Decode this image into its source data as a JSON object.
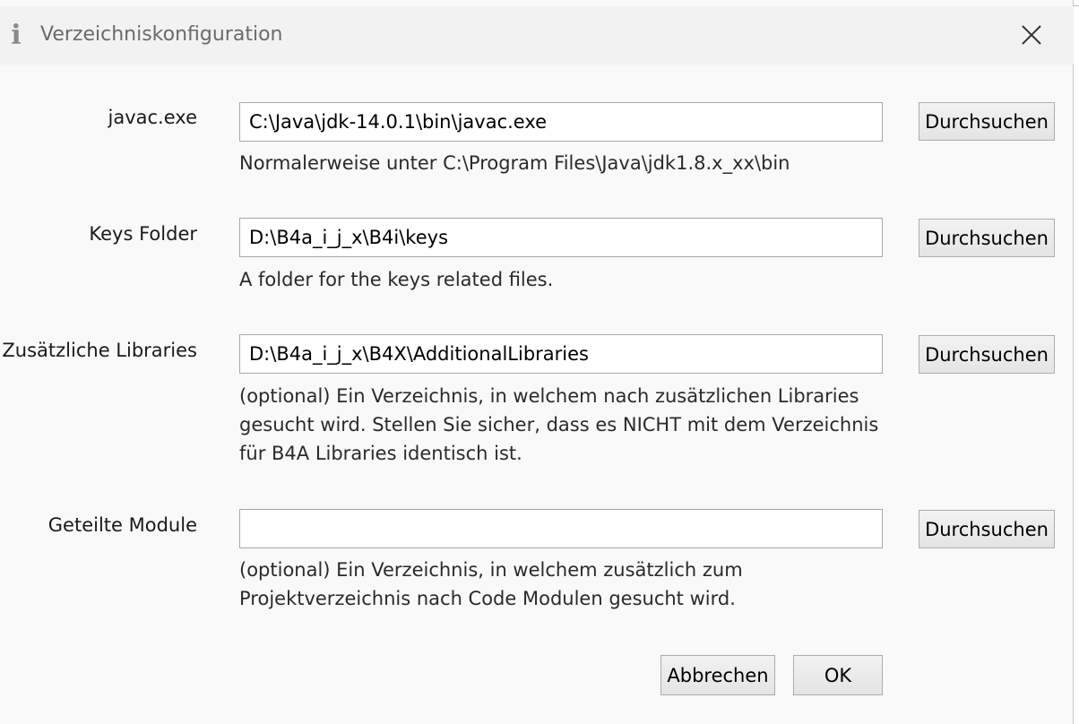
{
  "dialog": {
    "title": "Verzeichniskonfiguration",
    "title_icon": "info-icon",
    "close_icon": "close-icon"
  },
  "rows": [
    {
      "label": "javac.exe",
      "value": "C:\\Java\\jdk-14.0.1\\bin\\javac.exe",
      "browse_label": "Durchsuchen",
      "hint_lines": [
        "Normalerweise unter C:\\Program Files\\Java\\jdk1.8.x_xx\\bin"
      ]
    },
    {
      "label": "Keys Folder",
      "value": "D:\\B4a_i_j_x\\B4i\\keys",
      "browse_label": "Durchsuchen",
      "hint_lines": [
        "A folder for the keys related files."
      ]
    },
    {
      "label": "Zusätzliche Libraries",
      "value": "D:\\B4a_i_j_x\\B4X\\AdditionalLibraries",
      "browse_label": "Durchsuchen",
      "hint_lines": [
        "(optional) Ein Verzeichnis, in welchem nach zusätzlichen Libraries",
        "gesucht wird. Stellen Sie sicher, dass es NICHT mit dem Verzeichnis",
        "für B4A Libraries identisch ist."
      ]
    },
    {
      "label": "Geteilte Module",
      "value": "",
      "browse_label": "Durchsuchen",
      "hint_lines": [
        "(optional) Ein Verzeichnis, in welchem zusätzlich zum",
        "Projektverzeichnis nach Code Modulen gesucht wird."
      ]
    }
  ],
  "footer": {
    "cancel_label": "Abbrechen",
    "ok_label": "OK"
  }
}
